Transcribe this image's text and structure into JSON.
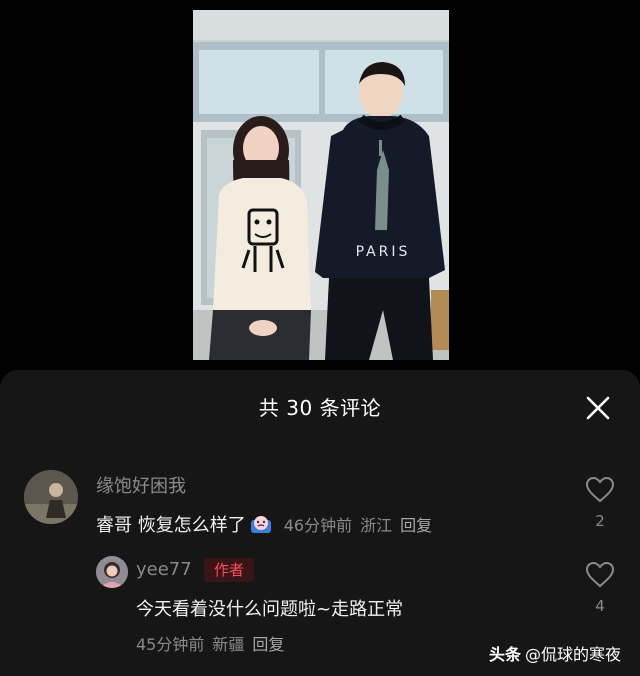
{
  "sheet": {
    "title": "共 30 条评论"
  },
  "comments": [
    {
      "username": "缘饱好困我",
      "text": "睿哥 恢复怎么样了",
      "emoji_icon": "sad-face-emoji-icon",
      "time": "46分钟前",
      "location": "浙江",
      "reply_label": "回复",
      "likes": "2"
    }
  ],
  "replies": [
    {
      "username": "yee77",
      "badge": "作者",
      "text": "今天看着没什么问题啦~走路正常",
      "time": "45分钟前",
      "location": "新疆",
      "reply_label": "回复",
      "likes": "4"
    }
  ],
  "watermark": {
    "brand": "头条",
    "handle": "@侃球的寒夜"
  },
  "colors": {
    "sheet_bg": "#161616",
    "author_badge": "#ff4d5a",
    "muted_text": "#8a8a8a"
  },
  "icons": [
    "close-icon",
    "heart-outline-icon"
  ]
}
